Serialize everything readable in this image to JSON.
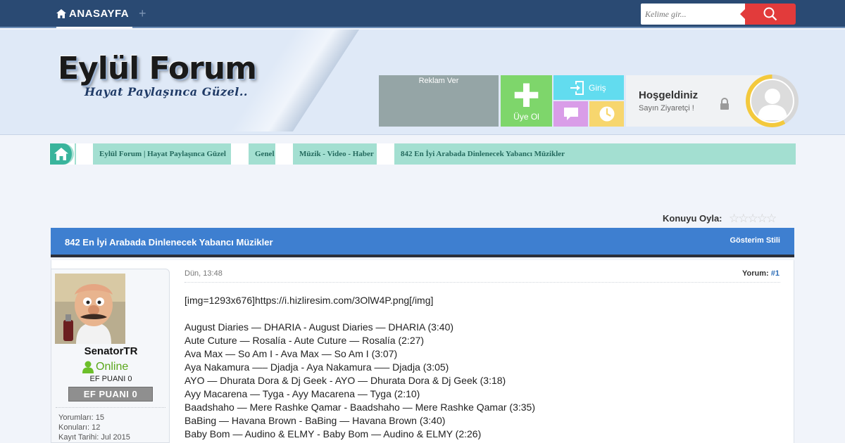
{
  "nav": {
    "home_label": "ANASAYFA",
    "search_placeholder": "Kelime gir..."
  },
  "header": {
    "logo_title": "Eylül Forum",
    "logo_subtitle": "Hayat Paylaşınca Güzel..",
    "ad_label": "Reklam Ver",
    "register_label": "Üye Ol",
    "login_label": "Giriş",
    "welcome_title": "Hoşgeldiniz",
    "welcome_sub": "Sayın Ziyaretçi !"
  },
  "breadcrumb": [
    "Eylül Forum | Hayat Paylaşınca Güzel",
    "Genel",
    "Müzik - Video - Haber",
    "842 En İyi Arabada Dinlenecek Yabancı Müzikler"
  ],
  "rating": {
    "label": "Konuyu Oyla:",
    "stars": 0,
    "max": 5
  },
  "thread": {
    "title": "842 En İyi Arabada Dinlenecek Yabancı Müzikler",
    "display_style": "Gösterim Stili"
  },
  "user": {
    "name": "SenatorTR",
    "status": "Online",
    "points_text": "EF PUANI 0",
    "badge_text": "EF PUANI 0",
    "comments": "Yorumları: 15",
    "topics": "Konuları: 12",
    "registered": "Kayıt Tarihi: Jul 2015"
  },
  "post": {
    "date": "Dün, 13:48",
    "number_label": "Yorum:",
    "number": "#1",
    "lines": [
      "[img=1293x676]https://i.hizliresim.com/3OlW4P.png[/img]",
      "",
      "August Diaries — DHARIA - August Diaries — DHARIA (3:40)",
      "Aute Cuture — Rosalía - Aute Cuture — Rosalía (2:27)",
      "Ava Max — So Am I - Ava Max — So Am I (3:07)",
      "Aya Nakamura —– Djadja - Aya Nakamura —– Djadja (3:05)",
      "AYO — Dhurata Dora & Dj Geek - AYO — Dhurata Dora & Dj Geek (3:18)",
      "Ayy Macarena — Tyga - Ayy Macarena — Tyga (2:10)",
      "Baadshaho — Mere Rashke Qamar - Baadshaho — Mere Rashke Qamar (3:35)",
      "BaBing — Havana Brown - BaBing — Havana Brown (3:40)",
      "Baby Bom — Audino & ELMY - Baby Bom — Audino & ELMY (2:26)"
    ]
  },
  "colors": {
    "topbar": "#2a4a73",
    "search_button": "#e23b3b",
    "register_tile": "#7ed66b",
    "login_tile": "#62dcef",
    "message_tile": "#d99de8",
    "clock_tile": "#f7d66e",
    "breadcrumb": "#a3dfd1",
    "thread_header": "#3e7fd0",
    "online": "#5aa71b"
  }
}
